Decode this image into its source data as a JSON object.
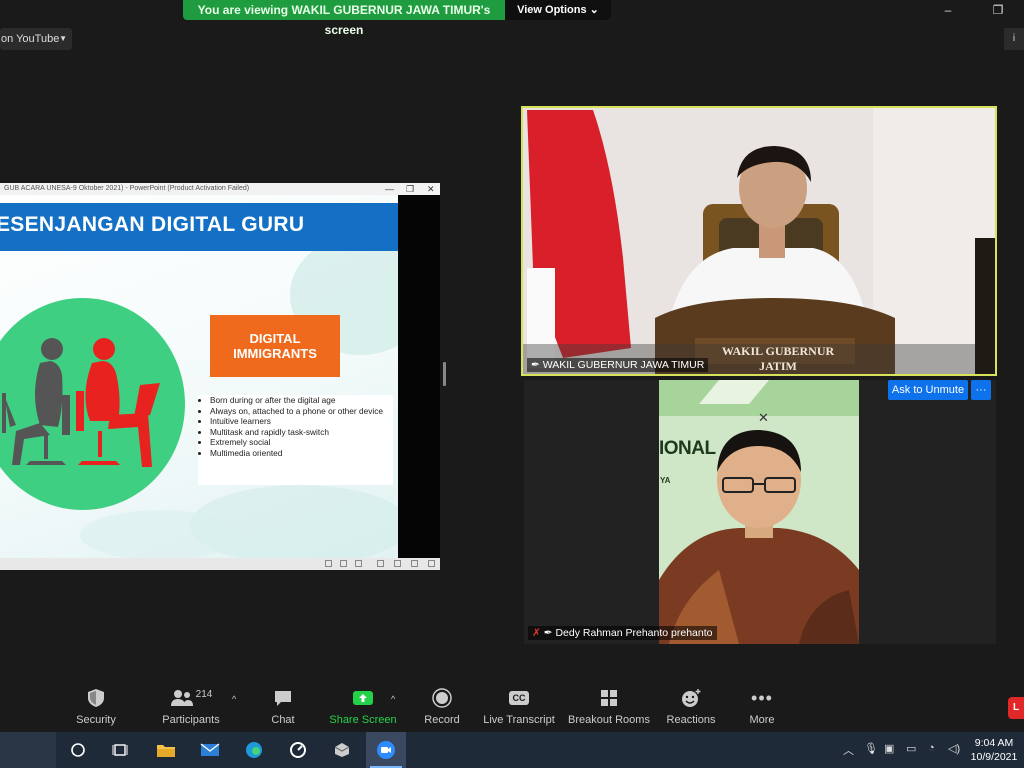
{
  "banner": {
    "message": "You are viewing WAKIL GUBERNUR JAWA TIMUR's screen",
    "view_options": "View Options"
  },
  "window_controls": {
    "minimize": "–",
    "restore": "❐"
  },
  "live_on": {
    "label": "on YouTube",
    "caret": "▼"
  },
  "info_button": "i",
  "shared_window": {
    "title": "GUB ACARA UNESA-9 Oktober 2021) - PowerPoint (Product Activation Failed)",
    "controls": [
      "—",
      "❐",
      "✕"
    ],
    "slide": {
      "heading": "ESENJANGAN DIGITAL GURU",
      "box_title_line1": "DIGITAL",
      "box_title_line2": "IMMIGRANTS",
      "bullets": [
        "Born during or after the digital age",
        "Always on, attached to a phone or other device",
        "Intuitive learners",
        "Multitask and rapidly task-switch",
        "Extremely social",
        "Multimedia oriented"
      ]
    }
  },
  "tiles": [
    {
      "name": "WAKIL GUBERNUR JAWA TIMUR",
      "desk_plate": "WAKIL GUBERNUR JATIM"
    },
    {
      "name": "Dedy Rahman Prehanto prehanto",
      "bg_text": "IONAL",
      "bg_text2": "YA"
    }
  ],
  "ask_to_unmute": "Ask to Unmute",
  "more_options": "···",
  "toolbar": {
    "security": "Security",
    "participants": "Participants",
    "participant_count": "214",
    "chat": "Chat",
    "share_screen": "Share Screen",
    "record": "Record",
    "live_transcript": "Live Transcript",
    "breakout_rooms": "Breakout Rooms",
    "reactions": "Reactions",
    "more": "More",
    "cc_label": "CC",
    "caret": "^"
  },
  "live_badge": "L",
  "taskbar": {
    "time": "9:04 AM",
    "date": "10/9/2021"
  },
  "colors": {
    "accent_blue": "#0e72ed",
    "share_green": "#24d24a",
    "active_speaker": "#d7e15a",
    "slide_blue": "#1470c4",
    "slide_orange": "#ef6a1d",
    "slide_green": "#3ecf82"
  }
}
